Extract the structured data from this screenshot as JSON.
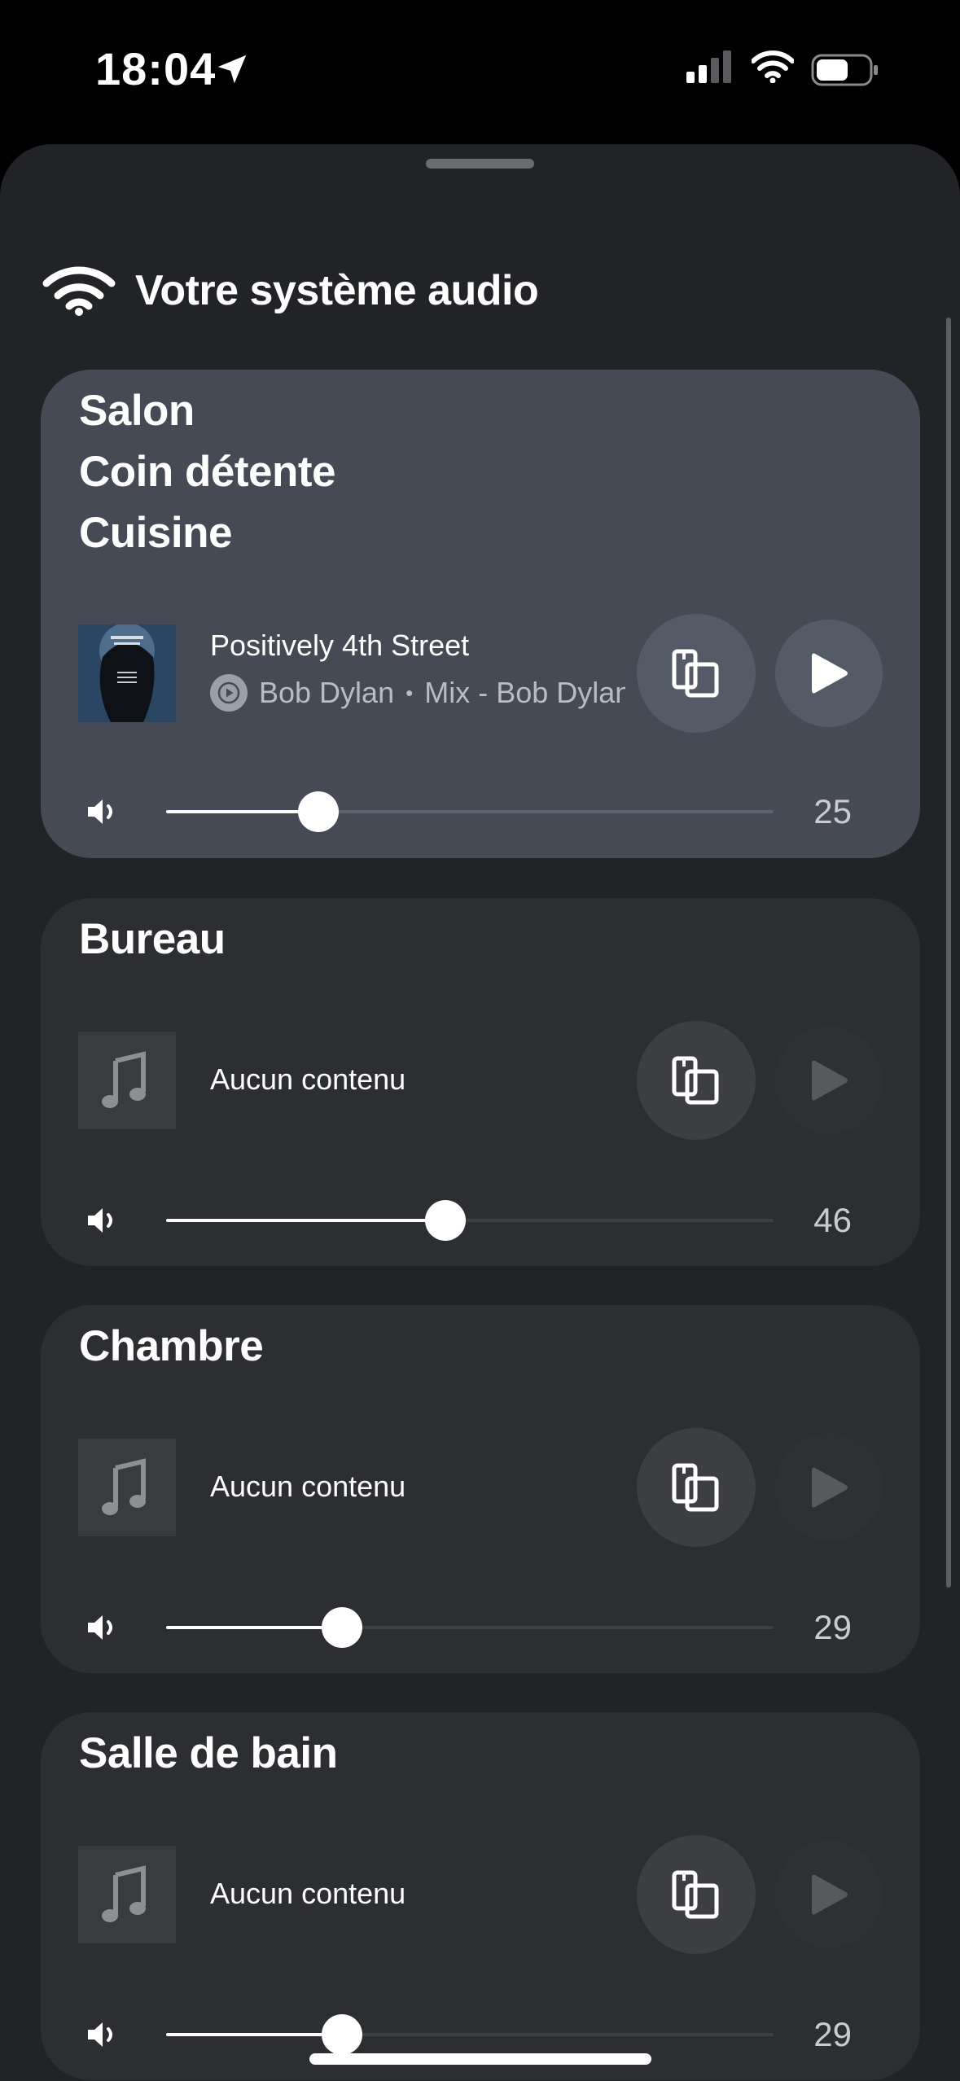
{
  "status_bar": {
    "time": "18:04",
    "icons": [
      "location-arrow-icon",
      "cellular-signal-icon",
      "wifi-icon",
      "battery-icon"
    ]
  },
  "sheet": {
    "title": "Votre système audio",
    "title_icon": "wifi-icon"
  },
  "rooms": [
    {
      "names": [
        "Salon",
        "Coin détente",
        "Cuisine"
      ],
      "active": true,
      "track_title": "Positively 4th Street",
      "artist": "Bob Dylan",
      "separator": "•",
      "source": "Mix - Bob Dylan",
      "volume": 25,
      "volume_label": "25"
    },
    {
      "names": [
        "Bureau"
      ],
      "active": false,
      "track_title": "Aucun contenu",
      "volume": 46,
      "volume_label": "46"
    },
    {
      "names": [
        "Chambre"
      ],
      "active": false,
      "track_title": "Aucun contenu",
      "volume": 29,
      "volume_label": "29"
    },
    {
      "names": [
        "Salle de bain"
      ],
      "active": false,
      "track_title": "Aucun contenu",
      "volume": 29,
      "volume_label": "29"
    }
  ],
  "colors": {
    "background": "#222326",
    "card": "#2d2e32",
    "active_card": "#454a55",
    "accent": "#ffffff"
  }
}
